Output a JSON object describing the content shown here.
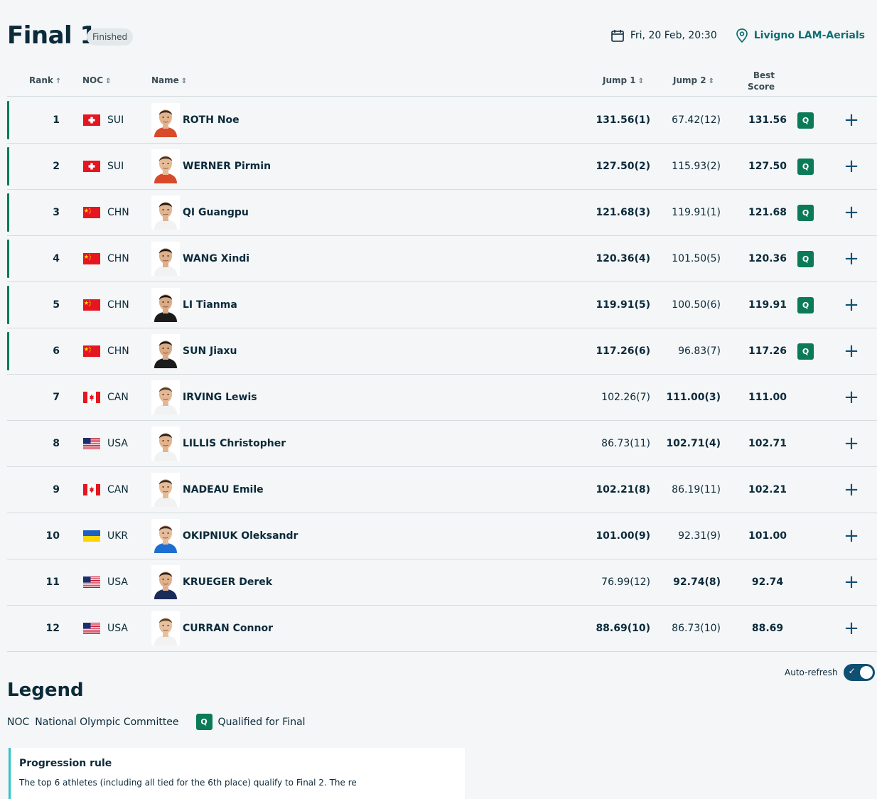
{
  "header": {
    "title": "Final 1",
    "status": "Finished",
    "date": "Fri, 20 Feb, 20:30",
    "venue": "Livigno LAM-Aerials"
  },
  "columns": {
    "rank": "Rank",
    "noc": "NOC",
    "name": "Name",
    "jump1": "Jump 1",
    "jump2": "Jump 2",
    "best_line1": "Best",
    "best_line2": "Score"
  },
  "rows": [
    {
      "rank": "1",
      "noc": "SUI",
      "name": "ROTH Noe",
      "j1": "131.56(1)",
      "j2": "67.42(12)",
      "best": "131.56",
      "q": "Q"
    },
    {
      "rank": "2",
      "noc": "SUI",
      "name": "WERNER Pirmin",
      "j1": "127.50(2)",
      "j2": "115.93(2)",
      "best": "127.50",
      "q": "Q"
    },
    {
      "rank": "3",
      "noc": "CHN",
      "name": "QI Guangpu",
      "j1": "121.68(3)",
      "j2": "119.91(1)",
      "best": "121.68",
      "q": "Q"
    },
    {
      "rank": "4",
      "noc": "CHN",
      "name": "WANG Xindi",
      "j1": "120.36(4)",
      "j2": "101.50(5)",
      "best": "120.36",
      "q": "Q"
    },
    {
      "rank": "5",
      "noc": "CHN",
      "name": "LI Tianma",
      "j1": "119.91(5)",
      "j2": "100.50(6)",
      "best": "119.91",
      "q": "Q"
    },
    {
      "rank": "6",
      "noc": "CHN",
      "name": "SUN Jiaxu",
      "j1": "117.26(6)",
      "j2": "96.83(7)",
      "best": "117.26",
      "q": "Q"
    },
    {
      "rank": "7",
      "noc": "CAN",
      "name": "IRVING Lewis",
      "j1": "102.26(7)",
      "j2": "111.00(3)",
      "best": "111.00",
      "q": ""
    },
    {
      "rank": "8",
      "noc": "USA",
      "name": "LILLIS Christopher",
      "j1": "86.73(11)",
      "j2": "102.71(4)",
      "best": "102.71",
      "q": ""
    },
    {
      "rank": "9",
      "noc": "CAN",
      "name": "NADEAU Emile",
      "j1": "102.21(8)",
      "j2": "86.19(11)",
      "best": "102.21",
      "q": ""
    },
    {
      "rank": "10",
      "noc": "UKR",
      "name": "OKIPNIUK Oleksandr",
      "j1": "101.00(9)",
      "j2": "92.31(9)",
      "best": "101.00",
      "q": ""
    },
    {
      "rank": "11",
      "noc": "USA",
      "name": "KRUEGER Derek",
      "j1": "76.99(12)",
      "j2": "92.74(8)",
      "best": "92.74",
      "q": ""
    },
    {
      "rank": "12",
      "noc": "USA",
      "name": "CURRAN Connor",
      "j1": "88.69(10)",
      "j2": "86.73(10)",
      "best": "88.69",
      "q": ""
    }
  ],
  "auto_refresh": {
    "label": "Auto-refresh",
    "enabled": true
  },
  "legend": {
    "title": "Legend",
    "noc_abbr": "NOC",
    "noc_desc": "National Olympic Committee",
    "q_abbr": "Q",
    "q_desc": "Qualified for Final"
  },
  "progression": {
    "title": "Progression rule",
    "text": "The top 6 athletes (including all tied for the 6th place) qualify to Final 2. The re"
  },
  "colors": {
    "qualified": "#0b7a56",
    "accent": "#0e6e72",
    "toggle": "#0e4f72"
  }
}
